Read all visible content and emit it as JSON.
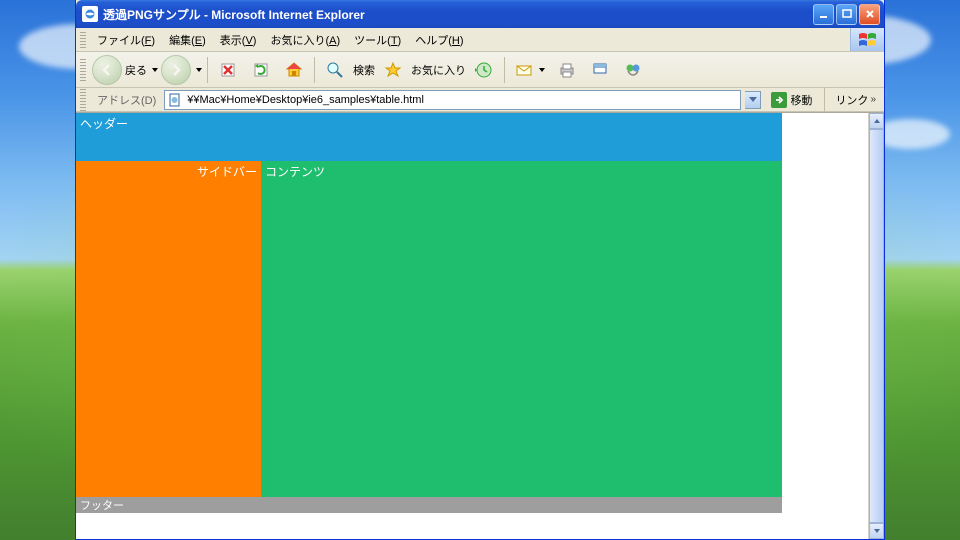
{
  "window": {
    "title": "透過PNGサンプル - Microsoft Internet Explorer"
  },
  "menubar": {
    "items": [
      {
        "label": "ファイル",
        "accel": "F"
      },
      {
        "label": "編集",
        "accel": "E"
      },
      {
        "label": "表示",
        "accel": "V"
      },
      {
        "label": "お気に入り",
        "accel": "A"
      },
      {
        "label": "ツール",
        "accel": "T"
      },
      {
        "label": "ヘルプ",
        "accel": "H"
      }
    ]
  },
  "toolbar": {
    "back_label": "戻る",
    "search_label": "検索",
    "favorites_label": "お気に入り"
  },
  "addressbar": {
    "label": "アドレス(D)",
    "value": "¥¥Mac¥Home¥Desktop¥ie6_samples¥table.html",
    "go_label": "移動",
    "links_label": "リンク"
  },
  "page": {
    "header": "ヘッダー",
    "sidebar": "サイドバー",
    "content": "コンテンツ",
    "footer": "フッター"
  }
}
